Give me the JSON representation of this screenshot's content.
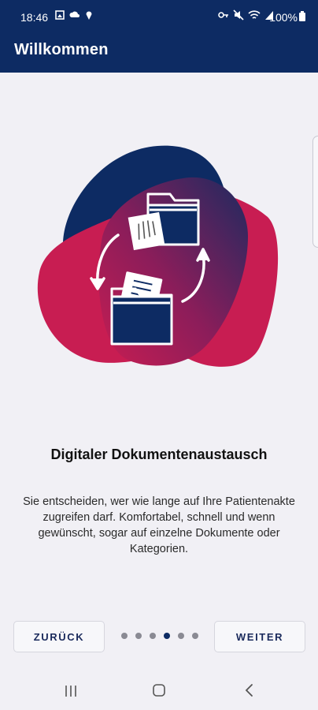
{
  "status_bar": {
    "time": "18:46",
    "battery": "100%",
    "left_icons": [
      "gallery-icon",
      "cloud-icon",
      "location-icon"
    ],
    "right_icons": [
      "key-icon",
      "mute-icon",
      "wifi-icon",
      "signal-icon"
    ]
  },
  "app_bar": {
    "title": "Willkommen"
  },
  "onboarding": {
    "headline": "Digitaler Dokumentenaustausch",
    "description": "Sie entscheiden, wer wie lange auf Ihre Patientenakte zugreifen darf. Komfortabel, schnell und wenn gewünscht, sogar auf einzelne Dokumente oder Kategorien.",
    "illustration_icons": [
      "folder-icon",
      "xray-document-icon",
      "document-folder-icon",
      "sync-arrows-icon"
    ],
    "page_count": 6,
    "current_page": 4
  },
  "buttons": {
    "back_label": "ZURÜCK",
    "next_label": "WEITER"
  },
  "nav_bar": {
    "items": [
      "recents-icon",
      "home-icon",
      "back-icon"
    ]
  },
  "colors": {
    "primary": "#0d2b63",
    "accent": "#c81d52",
    "background": "#f1f0f5"
  }
}
